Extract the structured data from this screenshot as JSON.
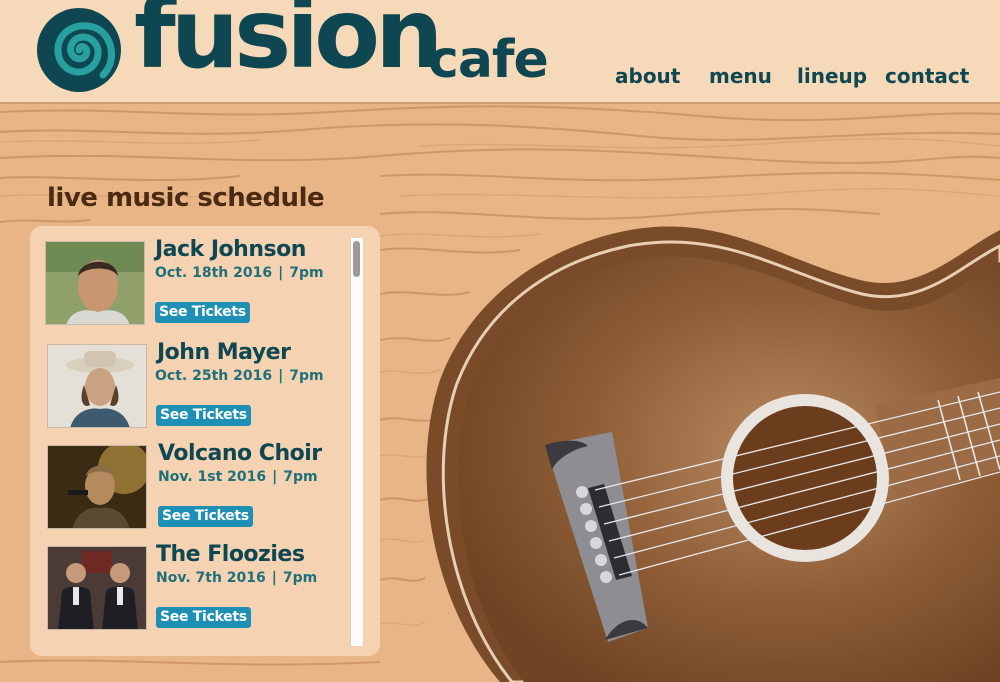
{
  "brand": {
    "name": "fusion",
    "suffix": "cafe",
    "color": "#0e4751"
  },
  "nav": {
    "items": [
      {
        "label": "about"
      },
      {
        "label": "menu"
      },
      {
        "label": "lineup"
      },
      {
        "label": "contact"
      }
    ]
  },
  "schedule": {
    "title": "live music schedule",
    "events": [
      {
        "name": "Jack Johnson",
        "date": "Oct. 18th 2016",
        "time": "7pm",
        "button": "See Tickets",
        "photo": "jack-johnson-photo"
      },
      {
        "name": "John Mayer",
        "date": "Oct. 25th 2016",
        "time": "7pm",
        "button": "See Tickets",
        "photo": "john-mayer-photo"
      },
      {
        "name": "Volcano Choir",
        "date": "Nov. 1st 2016",
        "time": "7pm",
        "button": "See Tickets",
        "photo": "volcano-choir-photo"
      },
      {
        "name": "The Floozies",
        "date": "Nov. 7th 2016",
        "time": "7pm",
        "button": "See Tickets",
        "photo": "the-floozies-photo"
      }
    ]
  },
  "colors": {
    "wood": "#e8b587",
    "header": "#f6d9b8",
    "accent_button": "#1e8fb5",
    "heading": "#4a2a12",
    "guitar_body": "#8a5a33"
  }
}
